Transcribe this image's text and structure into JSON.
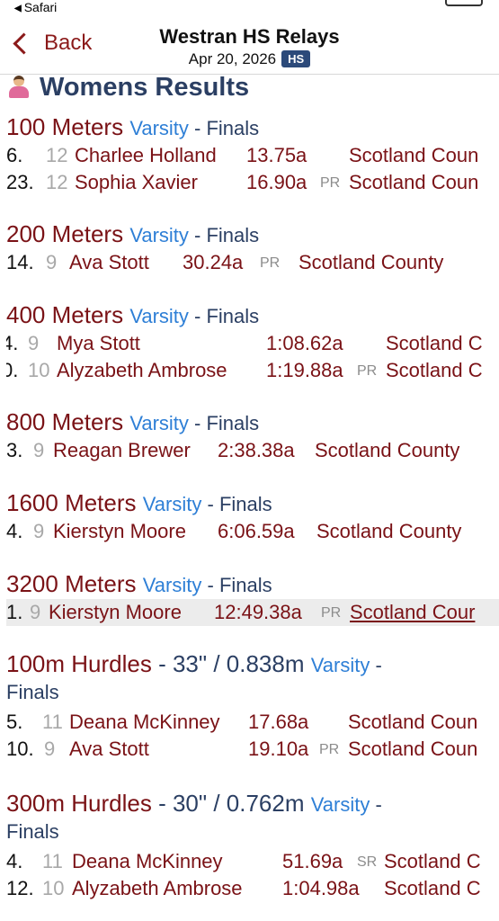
{
  "status": {
    "app_back": "Safari"
  },
  "nav": {
    "back_label": "Back",
    "title": "Westran HS Relays",
    "date": "Apr 20, 2026",
    "badge": "HS"
  },
  "section": {
    "title": "Womens Results",
    "icon": "woman-icon"
  },
  "events": [
    {
      "name": "100 Meters",
      "level": "Varsity",
      "sep": " - ",
      "round": "Finals",
      "results": [
        {
          "place": "6.",
          "grade": "12",
          "name": "Charlee Holland",
          "mark": "13.75a",
          "note": "",
          "team": "Scotland Coun"
        },
        {
          "place": "23.",
          "grade": "12",
          "name": "Sophia Xavier",
          "mark": "16.90a",
          "note": "PR",
          "team": "Scotland Coun"
        }
      ]
    },
    {
      "name": "200 Meters",
      "level": "Varsity",
      "sep": " - ",
      "round": "Finals",
      "results": [
        {
          "place": "14.",
          "grade": "9",
          "name": "Ava Stott",
          "mark": "30.24a",
          "note": "PR",
          "team": "Scotland County"
        }
      ]
    },
    {
      "name": "400 Meters",
      "level": "Varsity",
      "sep": " - ",
      "round": "Finals",
      "results": [
        {
          "place": "4.",
          "grade": "9",
          "name": "Mya Stott",
          "mark": "1:08.62a",
          "note": "",
          "team": "Scotland C"
        },
        {
          "place": "0.",
          "grade": "10",
          "name": "Alyzabeth Ambrose",
          "mark": "1:19.88a",
          "note": "PR",
          "team": "Scotland C"
        }
      ]
    },
    {
      "name": "800 Meters",
      "level": "Varsity",
      "sep": " - ",
      "round": "Finals",
      "results": [
        {
          "place": "3.",
          "grade": "9",
          "name": "Reagan Brewer",
          "mark": "2:38.38a",
          "note": "",
          "team": "Scotland County"
        }
      ]
    },
    {
      "name": "1600 Meters",
      "level": "Varsity",
      "sep": " - ",
      "round": "Finals",
      "results": [
        {
          "place": "4.",
          "grade": "9",
          "name": "Kierstyn Moore",
          "mark": "6:06.59a",
          "note": "",
          "team": "Scotland County"
        }
      ]
    },
    {
      "name": "3200 Meters",
      "level": "Varsity",
      "sep": " - ",
      "round": "Finals",
      "results": [
        {
          "place": "1.",
          "grade": "9",
          "name": "Kierstyn Moore",
          "mark": "12:49.38a",
          "note": "PR",
          "team": "Scotland Cour"
        }
      ]
    },
    {
      "name": "100m Hurdles",
      "spec": " - 33\" / 0.838m ",
      "level": "Varsity",
      "sep": " -",
      "round": "Finals",
      "results": [
        {
          "place": "5.",
          "grade": "11",
          "name": "Deana McKinney",
          "mark": "17.68a",
          "note": "",
          "team": "Scotland Coun"
        },
        {
          "place": "10.",
          "grade": "9",
          "name": "Ava Stott",
          "mark": "19.10a",
          "note": "PR",
          "team": "Scotland Coun"
        }
      ]
    },
    {
      "name": "300m Hurdles",
      "spec": " - 30\" / 0.762m ",
      "level": "Varsity",
      "sep": " -",
      "round": "Finals",
      "results": [
        {
          "place": "4.",
          "grade": "11",
          "name": "Deana McKinney",
          "mark": "51.69a",
          "note": "SR",
          "team": "Scotland C"
        },
        {
          "place": "12.",
          "grade": "10",
          "name": "Alyzabeth Ambrose",
          "mark": "1:04.98a",
          "note": "",
          "team": "Scotland C"
        }
      ]
    }
  ]
}
